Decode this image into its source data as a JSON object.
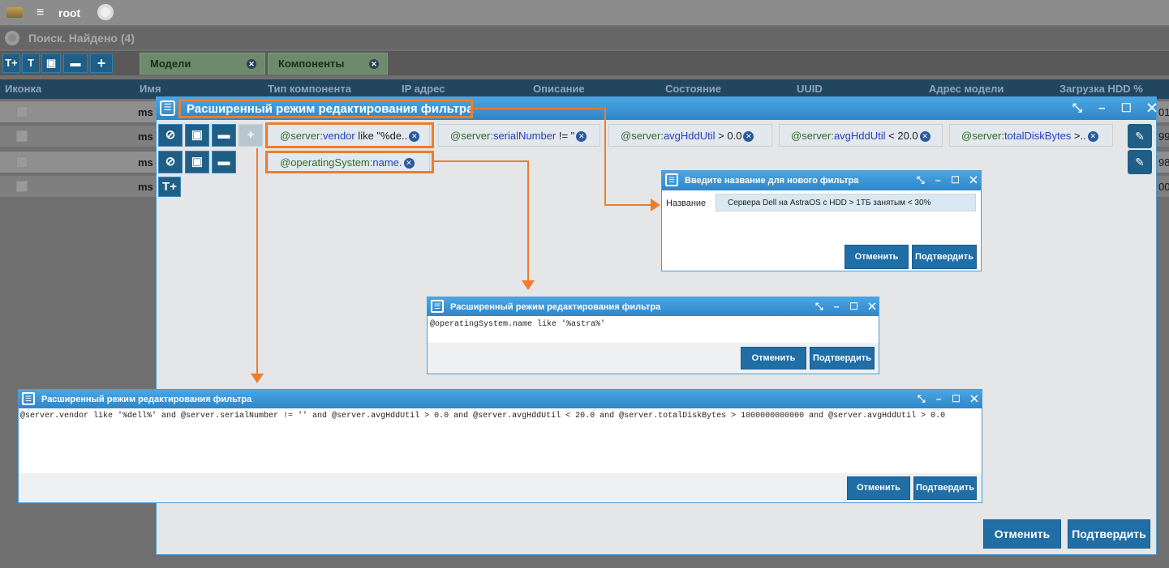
{
  "topbar": {
    "menu_icon": "hamburger-icon",
    "user": "root"
  },
  "search": {
    "title": "Поиск. Найдено (4)"
  },
  "toolbar": {
    "buttons": [
      "Т+",
      "Т",
      "💾",
      "📁",
      "+"
    ],
    "tabs": [
      {
        "label": "Модели",
        "close": "✕"
      },
      {
        "label": "Компоненты",
        "close": "✕"
      }
    ]
  },
  "table": {
    "columns": [
      "Иконка",
      "Имя",
      "Тип компонента",
      "IP адрес",
      "Описание",
      "Состояние",
      "UUID",
      "Адрес модели",
      "Загрузка HDD %"
    ],
    "rows": [
      {
        "name": "ms",
        "end": "01"
      },
      {
        "name": "ms",
        "end": "99"
      },
      {
        "name": "ms",
        "end": "98"
      },
      {
        "name": "ms",
        "end": "00"
      }
    ]
  },
  "main_dialog": {
    "title": "Расширенный режим редактирования фильтра",
    "controls": "⤡ – ☐ ✕",
    "row1_chips": [
      {
        "var": "@server:",
        "key": "vendor",
        "rest": " like \"%de..",
        "x": "✕"
      },
      {
        "var": "@server:",
        "key": "serialNumber",
        "rest": " != \"",
        "x": "✕"
      },
      {
        "var": "@server:",
        "key": "avgHddUtil",
        "rest": " > 0.0",
        "x": "✕"
      },
      {
        "var": "@server:",
        "key": "avgHddUtil",
        "rest": " < 20.0",
        "x": "✕"
      },
      {
        "var": "@server:",
        "key": "totalDiskBytes",
        "rest": " >..",
        "x": "✕"
      }
    ],
    "row2_chips": [
      {
        "var": "@operatingSystem:",
        "key": "name.",
        "rest": "",
        "x": "✕"
      }
    ],
    "cancel": "Отменить",
    "confirm": "Подтвердить"
  },
  "name_dialog": {
    "title": "Введите название для нового фильтра",
    "label": "Название",
    "value": "Сервера Dell на AstraOS с HDD > 1ТБ занятым < 30%",
    "cancel": "Отменить",
    "confirm": "Подтвердить",
    "controls": "⤡ – ☐ ✕"
  },
  "os_dialog": {
    "title": "Расширенный режим редактирования фильтра",
    "text": "@operatingSystem.name like '%astra%'",
    "cancel": "Отменить",
    "confirm": "Подтвердить",
    "controls": "⤡ – ☐ ✕"
  },
  "full_dialog": {
    "title": "Расширенный режим редактирования фильтра",
    "text": "@server.vendor like '%dell%' and @server.serialNumber != '' and @server.avgHddUtil > 0.0 and @server.avgHddUtil < 20.0 and @server.totalDiskBytes > 1000000000000 and @server.avgHddUtil > 0.0",
    "cancel": "Отменить",
    "confirm": "Подтвердить",
    "controls": "⤡ – ☐ ✕"
  },
  "colors": {
    "accent": "#2f86c8",
    "highlight": "#ef7d2a",
    "button": "#1f6ea6"
  }
}
